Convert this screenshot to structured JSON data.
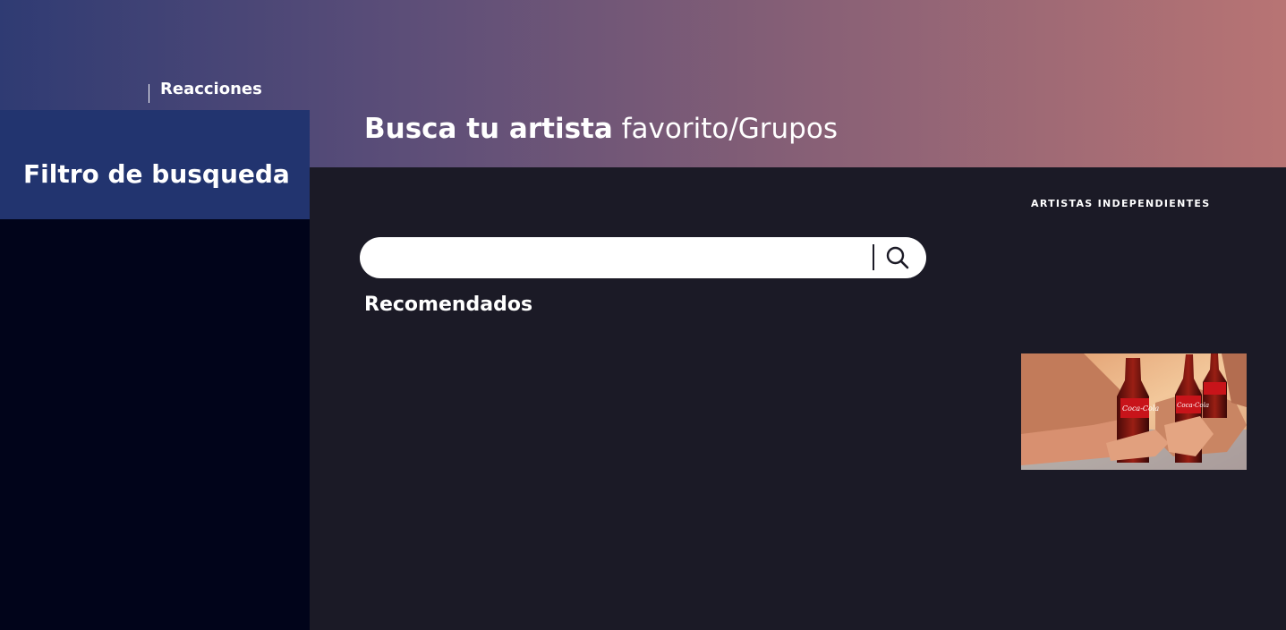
{
  "nav": {
    "reactions_label": "Reacciones"
  },
  "sidebar": {
    "title": "Filtro de busqueda"
  },
  "header": {
    "title_prefix": "Busca tu ",
    "title_emphasis": "artista",
    "title_suffix": " favorito/Grupos"
  },
  "main": {
    "section_label": "ARTISTAS INDEPENDIENTES",
    "search": {
      "value": "",
      "placeholder": "",
      "icon": "search-icon"
    },
    "recommended_label": "Recomendados",
    "promo": {
      "icon": "promo-image",
      "brand_text": "Coca-Cola"
    }
  },
  "colors": {
    "gradient_start": "#2f3b73",
    "gradient_end": "#b87474",
    "sidebar_head": "#22346f",
    "sidebar_body": "#01041a",
    "main_bg": "#1b1a26"
  }
}
